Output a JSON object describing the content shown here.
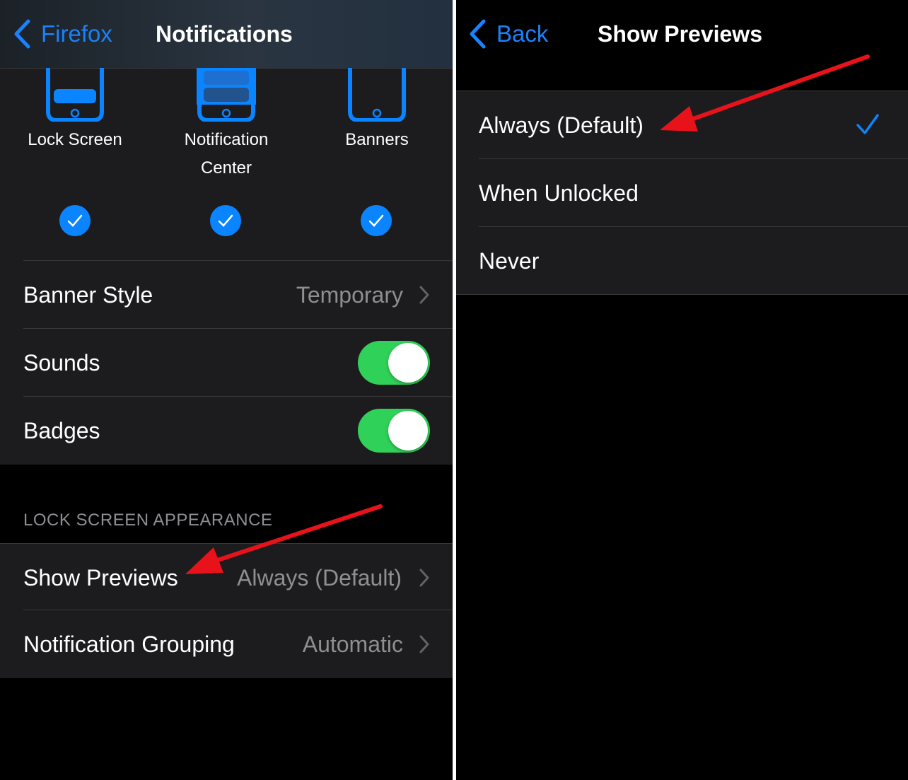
{
  "left": {
    "nav": {
      "back_label": "Firefox",
      "title": "Notifications"
    },
    "alert_styles": [
      {
        "label": "Lock Screen",
        "checked": true
      },
      {
        "label": "Notification Center",
        "checked": true
      },
      {
        "label": "Banners",
        "checked": true
      }
    ],
    "banner_style": {
      "label": "Banner Style",
      "value": "Temporary"
    },
    "sounds": {
      "label": "Sounds",
      "on": true
    },
    "badges": {
      "label": "Badges",
      "on": true
    },
    "section_header": "LOCK SCREEN APPEARANCE",
    "show_previews": {
      "label": "Show Previews",
      "value": "Always (Default)"
    },
    "grouping": {
      "label": "Notification Grouping",
      "value": "Automatic"
    }
  },
  "right": {
    "nav": {
      "back_label": "Back",
      "title": "Show Previews"
    },
    "options": [
      {
        "label": "Always (Default)",
        "selected": true
      },
      {
        "label": "When Unlocked",
        "selected": false
      },
      {
        "label": "Never",
        "selected": false
      }
    ]
  },
  "colors": {
    "accent": "#0a84ff",
    "link": "#1a82fb",
    "toggle_on": "#30d158",
    "annotation_arrow": "#e8121b"
  }
}
